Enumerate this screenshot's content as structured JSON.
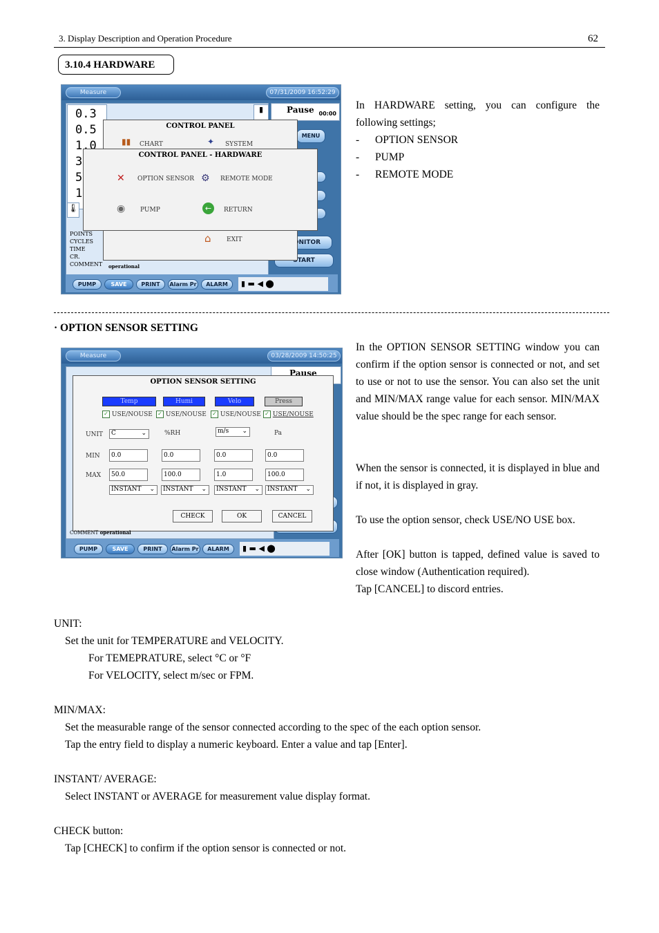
{
  "header": {
    "chapter": "3. Display Description and Operation Procedure",
    "page_number": "62"
  },
  "section": {
    "title": "3.10.4 HARDWARE"
  },
  "hardware_text": {
    "intro": "In HARDWARE setting, you can configure the following settings;",
    "items": [
      "OPTION SENSOR",
      "PUMP",
      "REMOTE MODE"
    ]
  },
  "screen1": {
    "tab": "Measure",
    "datetime": "07/31/2009 16:52:29",
    "readings": [
      "0.3",
      "0.5",
      "1.0",
      "3",
      "5",
      "10"
    ],
    "pause_label": "Pause",
    "pause_time": "00:00",
    "side_labels": [
      "MENU",
      "MONITOR",
      "START"
    ],
    "info_labels": [
      "POINTS",
      "CYCLES",
      "TIME",
      "CR.",
      "COMMENT"
    ],
    "comment_value": "operational",
    "control_panel": {
      "title": "CONTROL PANEL",
      "items": [
        "CHART",
        "SYSTEM"
      ],
      "exit": "EXIT"
    },
    "hardware_panel": {
      "title": "CONTROL PANEL - HARDWARE",
      "items": [
        "OPTION SENSOR",
        "REMOTE MODE",
        "PUMP",
        "RETURN"
      ]
    },
    "bottom_buttons": [
      "PUMP",
      "SAVE",
      "PRINT",
      "Alarm Pr",
      "ALARM"
    ]
  },
  "option_section": {
    "title": "· OPTION SENSOR SETTING",
    "paragraphs": [
      "In the OPTION SENSOR SETTING window you can confirm if the option sensor is connected or not, and set to use or not to use the sensor. You can also set the unit and MIN/MAX range value for each sensor. MIN/MAX value should be the spec range for each sensor.",
      "When the sensor is connected, it is displayed in blue and if not, it is displayed in gray.",
      "To use the option sensor, check USE/NO USE box.",
      "After [OK] button is tapped, defined value is saved to close window (Authentication required).",
      "Tap [CANCEL] to discord entries."
    ]
  },
  "screen2": {
    "tab": "Measure",
    "datetime": "03/28/2009 14:50:25",
    "pause_label": "Pause",
    "dialog": {
      "title": "OPTION SENSOR SETTING",
      "sensors": [
        "Temp",
        "Humi",
        "Velo",
        "Press"
      ],
      "use_label": "USE/NOUSE",
      "row_labels": [
        "UNIT",
        "MIN",
        "MAX"
      ],
      "units": [
        "C",
        "%RH",
        "m/s",
        "Pa"
      ],
      "min": [
        "0.0",
        "0.0",
        "0.0",
        "0.0"
      ],
      "max": [
        "50.0",
        "100.0",
        "1.0",
        "100.0"
      ],
      "mode": [
        "INSTANT",
        "INSTANT",
        "INSTANT",
        "INSTANT"
      ],
      "buttons": [
        "CHECK",
        "OK",
        "CANCEL"
      ]
    },
    "comment_label": "COMMENT",
    "comment_value": "operational",
    "bottom_buttons": [
      "PUMP",
      "SAVE",
      "PRINT",
      "Alarm Pr",
      "ALARM"
    ]
  },
  "definitions": {
    "unit_head": "UNIT:",
    "unit_lines": [
      "Set the unit for TEMPERATURE and VELOCITY.",
      "For TEMEPRATURE, select °C or °F",
      "For VELOCITY, select m/sec or FPM."
    ],
    "minmax_head": "MIN/MAX:",
    "minmax_lines": [
      "Set the measurable range of the sensor connected according to the spec of the each option sensor.",
      "Tap the entry field to display a numeric keyboard. Enter a value and tap [Enter]."
    ],
    "instant_head": "INSTANT/ AVERAGE:",
    "instant_lines": [
      "Select INSTANT or AVERAGE for measurement value display format."
    ],
    "check_head": "CHECK button:",
    "check_lines": [
      "Tap [CHECK] to confirm if the option sensor is connected or not."
    ]
  },
  "colors": {
    "sensor_connected": "#1a3cff",
    "sensor_disconnected": "#c8c8c8",
    "screen_frame": "#3f74a8"
  }
}
